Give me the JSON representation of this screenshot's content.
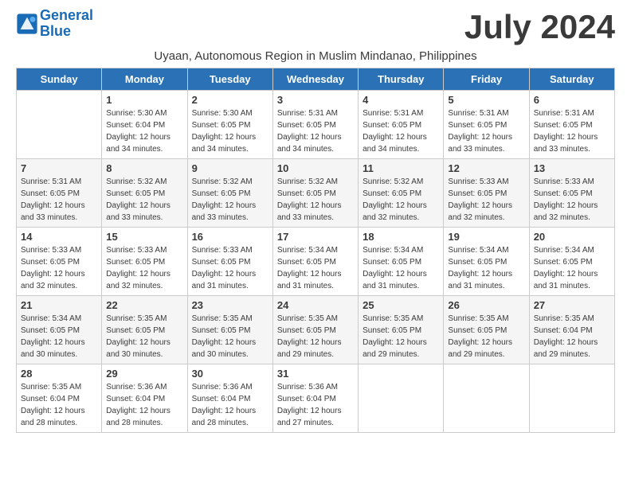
{
  "logo": {
    "general": "General",
    "blue": "Blue"
  },
  "title": {
    "month_year": "July 2024",
    "location": "Uyaan, Autonomous Region in Muslim Mindanao, Philippines"
  },
  "weekdays": [
    "Sunday",
    "Monday",
    "Tuesday",
    "Wednesday",
    "Thursday",
    "Friday",
    "Saturday"
  ],
  "weeks": [
    [
      {
        "day": "",
        "sunrise": "",
        "sunset": "",
        "daylight": ""
      },
      {
        "day": "1",
        "sunrise": "Sunrise: 5:30 AM",
        "sunset": "Sunset: 6:04 PM",
        "daylight": "Daylight: 12 hours and 34 minutes."
      },
      {
        "day": "2",
        "sunrise": "Sunrise: 5:30 AM",
        "sunset": "Sunset: 6:05 PM",
        "daylight": "Daylight: 12 hours and 34 minutes."
      },
      {
        "day": "3",
        "sunrise": "Sunrise: 5:31 AM",
        "sunset": "Sunset: 6:05 PM",
        "daylight": "Daylight: 12 hours and 34 minutes."
      },
      {
        "day": "4",
        "sunrise": "Sunrise: 5:31 AM",
        "sunset": "Sunset: 6:05 PM",
        "daylight": "Daylight: 12 hours and 34 minutes."
      },
      {
        "day": "5",
        "sunrise": "Sunrise: 5:31 AM",
        "sunset": "Sunset: 6:05 PM",
        "daylight": "Daylight: 12 hours and 33 minutes."
      },
      {
        "day": "6",
        "sunrise": "Sunrise: 5:31 AM",
        "sunset": "Sunset: 6:05 PM",
        "daylight": "Daylight: 12 hours and 33 minutes."
      }
    ],
    [
      {
        "day": "7",
        "sunrise": "Sunrise: 5:31 AM",
        "sunset": "Sunset: 6:05 PM",
        "daylight": "Daylight: 12 hours and 33 minutes."
      },
      {
        "day": "8",
        "sunrise": "Sunrise: 5:32 AM",
        "sunset": "Sunset: 6:05 PM",
        "daylight": "Daylight: 12 hours and 33 minutes."
      },
      {
        "day": "9",
        "sunrise": "Sunrise: 5:32 AM",
        "sunset": "Sunset: 6:05 PM",
        "daylight": "Daylight: 12 hours and 33 minutes."
      },
      {
        "day": "10",
        "sunrise": "Sunrise: 5:32 AM",
        "sunset": "Sunset: 6:05 PM",
        "daylight": "Daylight: 12 hours and 33 minutes."
      },
      {
        "day": "11",
        "sunrise": "Sunrise: 5:32 AM",
        "sunset": "Sunset: 6:05 PM",
        "daylight": "Daylight: 12 hours and 32 minutes."
      },
      {
        "day": "12",
        "sunrise": "Sunrise: 5:33 AM",
        "sunset": "Sunset: 6:05 PM",
        "daylight": "Daylight: 12 hours and 32 minutes."
      },
      {
        "day": "13",
        "sunrise": "Sunrise: 5:33 AM",
        "sunset": "Sunset: 6:05 PM",
        "daylight": "Daylight: 12 hours and 32 minutes."
      }
    ],
    [
      {
        "day": "14",
        "sunrise": "Sunrise: 5:33 AM",
        "sunset": "Sunset: 6:05 PM",
        "daylight": "Daylight: 12 hours and 32 minutes."
      },
      {
        "day": "15",
        "sunrise": "Sunrise: 5:33 AM",
        "sunset": "Sunset: 6:05 PM",
        "daylight": "Daylight: 12 hours and 32 minutes."
      },
      {
        "day": "16",
        "sunrise": "Sunrise: 5:33 AM",
        "sunset": "Sunset: 6:05 PM",
        "daylight": "Daylight: 12 hours and 31 minutes."
      },
      {
        "day": "17",
        "sunrise": "Sunrise: 5:34 AM",
        "sunset": "Sunset: 6:05 PM",
        "daylight": "Daylight: 12 hours and 31 minutes."
      },
      {
        "day": "18",
        "sunrise": "Sunrise: 5:34 AM",
        "sunset": "Sunset: 6:05 PM",
        "daylight": "Daylight: 12 hours and 31 minutes."
      },
      {
        "day": "19",
        "sunrise": "Sunrise: 5:34 AM",
        "sunset": "Sunset: 6:05 PM",
        "daylight": "Daylight: 12 hours and 31 minutes."
      },
      {
        "day": "20",
        "sunrise": "Sunrise: 5:34 AM",
        "sunset": "Sunset: 6:05 PM",
        "daylight": "Daylight: 12 hours and 31 minutes."
      }
    ],
    [
      {
        "day": "21",
        "sunrise": "Sunrise: 5:34 AM",
        "sunset": "Sunset: 6:05 PM",
        "daylight": "Daylight: 12 hours and 30 minutes."
      },
      {
        "day": "22",
        "sunrise": "Sunrise: 5:35 AM",
        "sunset": "Sunset: 6:05 PM",
        "daylight": "Daylight: 12 hours and 30 minutes."
      },
      {
        "day": "23",
        "sunrise": "Sunrise: 5:35 AM",
        "sunset": "Sunset: 6:05 PM",
        "daylight": "Daylight: 12 hours and 30 minutes."
      },
      {
        "day": "24",
        "sunrise": "Sunrise: 5:35 AM",
        "sunset": "Sunset: 6:05 PM",
        "daylight": "Daylight: 12 hours and 29 minutes."
      },
      {
        "day": "25",
        "sunrise": "Sunrise: 5:35 AM",
        "sunset": "Sunset: 6:05 PM",
        "daylight": "Daylight: 12 hours and 29 minutes."
      },
      {
        "day": "26",
        "sunrise": "Sunrise: 5:35 AM",
        "sunset": "Sunset: 6:05 PM",
        "daylight": "Daylight: 12 hours and 29 minutes."
      },
      {
        "day": "27",
        "sunrise": "Sunrise: 5:35 AM",
        "sunset": "Sunset: 6:04 PM",
        "daylight": "Daylight: 12 hours and 29 minutes."
      }
    ],
    [
      {
        "day": "28",
        "sunrise": "Sunrise: 5:35 AM",
        "sunset": "Sunset: 6:04 PM",
        "daylight": "Daylight: 12 hours and 28 minutes."
      },
      {
        "day": "29",
        "sunrise": "Sunrise: 5:36 AM",
        "sunset": "Sunset: 6:04 PM",
        "daylight": "Daylight: 12 hours and 28 minutes."
      },
      {
        "day": "30",
        "sunrise": "Sunrise: 5:36 AM",
        "sunset": "Sunset: 6:04 PM",
        "daylight": "Daylight: 12 hours and 28 minutes."
      },
      {
        "day": "31",
        "sunrise": "Sunrise: 5:36 AM",
        "sunset": "Sunset: 6:04 PM",
        "daylight": "Daylight: 12 hours and 27 minutes."
      },
      {
        "day": "",
        "sunrise": "",
        "sunset": "",
        "daylight": ""
      },
      {
        "day": "",
        "sunrise": "",
        "sunset": "",
        "daylight": ""
      },
      {
        "day": "",
        "sunrise": "",
        "sunset": "",
        "daylight": ""
      }
    ]
  ]
}
